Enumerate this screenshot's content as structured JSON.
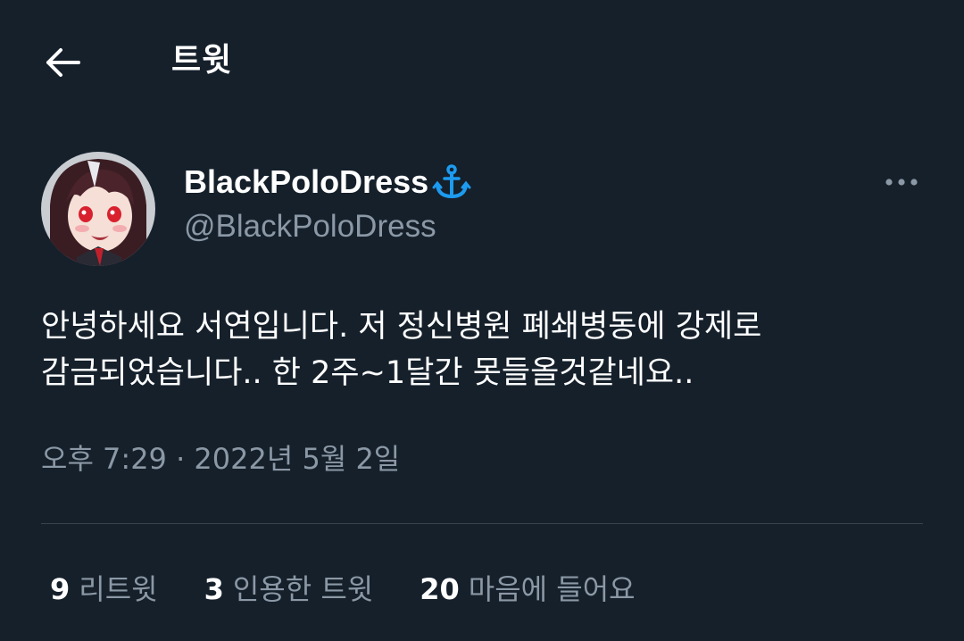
{
  "header": {
    "back_icon": "arrow-left-icon",
    "title": "트윗"
  },
  "tweet": {
    "author": {
      "display_name": "BlackPoloDress",
      "badge_icon": "anchor-icon",
      "handle": "@BlackPoloDress"
    },
    "more_icon": "more-horizontal-icon",
    "text_lines": [
      "안녕하세요 서연입니다. 저 정신병원 폐쇄병동에 강제로",
      "감금되었습니다.. 한 2주~1달간 못들올것같네요.."
    ],
    "timestamp": "오후 7:29 · 2022년 5월 2일",
    "stats": [
      {
        "count": "9",
        "label": "리트윗"
      },
      {
        "count": "3",
        "label": "인용한 트윗"
      },
      {
        "count": "20",
        "label": "마음에 들어요"
      }
    ]
  },
  "colors": {
    "background": "#15202b",
    "text_primary": "#ffffff",
    "text_secondary": "#8b98a5",
    "divider": "#38444d",
    "anchor_badge": "#1d9bf0"
  }
}
